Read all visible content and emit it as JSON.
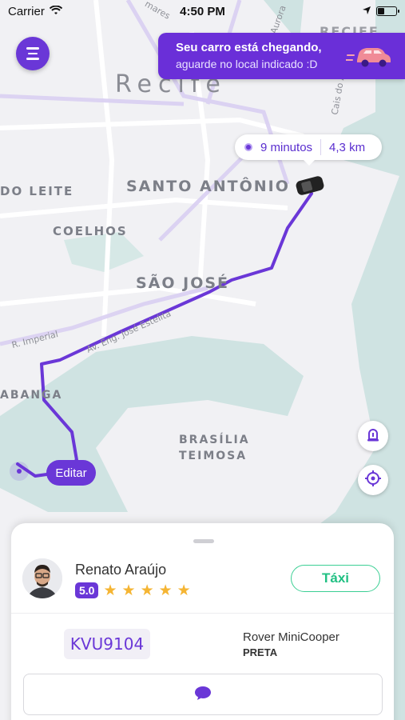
{
  "status_bar": {
    "carrier": "Carrier",
    "time": "4:50 PM"
  },
  "notification": {
    "title": "Seu carro está chegando,",
    "subtitle": "aguarde no local indicado :D"
  },
  "eta": {
    "time": "9 minutos",
    "distance": "4,3 km"
  },
  "map": {
    "labels": {
      "recife": "Recife",
      "recife_small": "RECIFE",
      "santo_antonio": "SANTO ANTÔNIO",
      "do_leite": "DO LEITE",
      "coelhos": "COELHOS",
      "sao_jose": "SÃO JOSÉ",
      "abanga": "ABANGA",
      "brasilia": "BRASÍLIA",
      "teimosa": "TEIMOSA",
      "r_imperial": "R. Imperial",
      "av_eng": "Av. Eng. José Estelita",
      "cais": "Cais do Apolo",
      "aurora": "Aurora",
      "mares": "mares"
    },
    "edit_label": "Editar"
  },
  "driver": {
    "name": "Renato Araújo",
    "rating": "5.0",
    "stars": 5,
    "service": "Táxi"
  },
  "vehicle": {
    "plate": "KVU9104",
    "model": "Rover MiniCooper",
    "color": "PRETA"
  },
  "colors": {
    "accent": "#6a37d7",
    "taxi": "#21c083",
    "star": "#f5b533"
  },
  "icons": [
    "menu-icon",
    "wifi-icon",
    "location-arrow-icon",
    "battery-icon",
    "car-icon",
    "alert-icon",
    "crosshair-icon",
    "chat-icon"
  ]
}
